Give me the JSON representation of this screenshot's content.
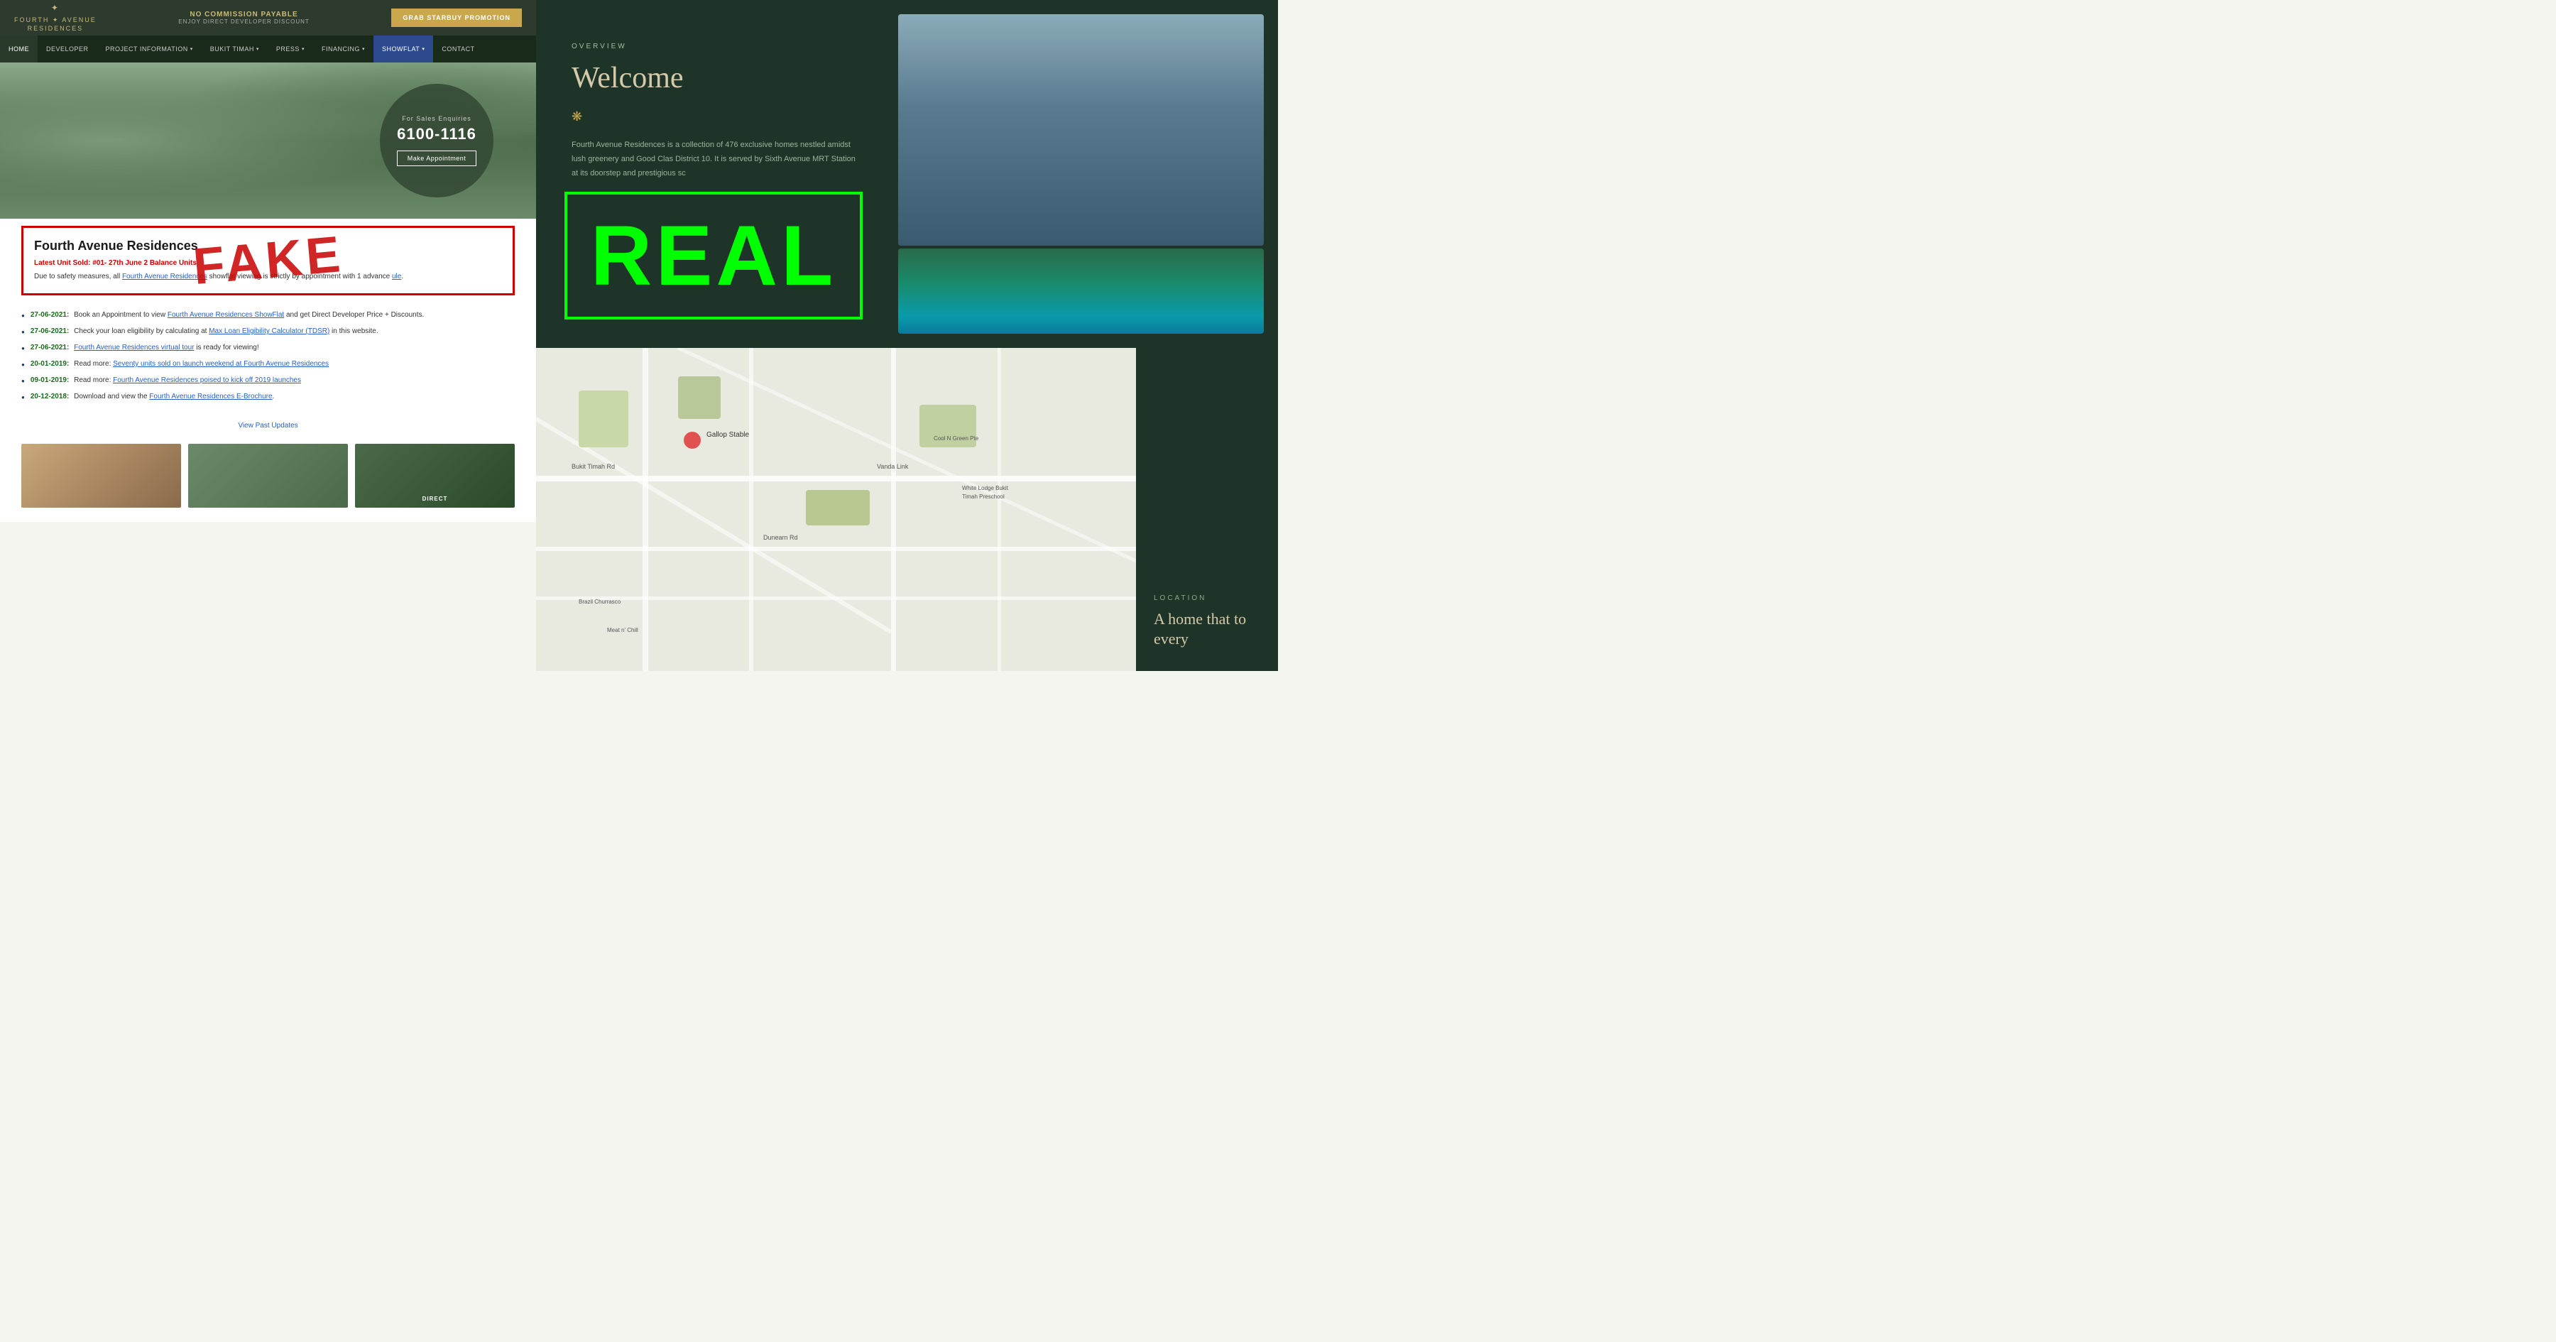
{
  "left": {
    "logo": {
      "line1": "FOURTH ✦ AVENUE",
      "line2": "RESIDENCES"
    },
    "banner": {
      "promo_title": "NO COMMISSION PAYABLE",
      "promo_sub": "ENJOY DIRECT DEVELOPER DISCOUNT",
      "grab_btn": "GRAB STARBUY PROMOTION"
    },
    "nav": {
      "items": [
        {
          "label": "HOME",
          "active": true
        },
        {
          "label": "DEVELOPER",
          "active": false
        },
        {
          "label": "PROJECT INFORMATION ▾",
          "active": false
        },
        {
          "label": "BUKIT TIMAH ▾",
          "active": false
        },
        {
          "label": "PRESS ▾",
          "active": false
        },
        {
          "label": "FINANCING ▾",
          "active": false
        },
        {
          "label": "SHOWFLAT ▾",
          "showflat": true
        },
        {
          "label": "CONTACT",
          "active": false
        }
      ]
    },
    "hero": {
      "enquiry": "For Sales Enquiries",
      "phone": "6100-1116",
      "appt_btn": "Make Appointment"
    },
    "fake_section": {
      "watermark": "FAKE",
      "title": "Fourth Avenue Residences",
      "subtitle": "d: 27th June 2",
      "latest": "Latest Unit Sold: #01-  27th June 2  Balance Units",
      "safety": "Due to safety measures, all Fourth Avenue Residences Showflat viewing is strictly by appointment with 1 advance  ule.",
      "unit_link": "Balance Units",
      "safety_link": "h Avenue Residences"
    },
    "updates": [
      {
        "date": "27-06-2021:",
        "text": "Book an Appointment to view ",
        "link": "Fourth Avenue Residences ShowFlat",
        "text2": " and get Direct Developer Price + Discounts."
      },
      {
        "date": "27-06-2021:",
        "text": "Check your loan eligibility by calculating at ",
        "link": "Max Loan Eligibility Calculator (TDSR)",
        "text2": " in this website."
      },
      {
        "date": "27-06-2021:",
        "text": "Fourth Avenue Residences virtual tour is ready for viewing!"
      },
      {
        "date": "20-01-2019:",
        "text": "Read more: ",
        "link": "Seventy units sold on launch weekend at Fourth Avenue Residences"
      },
      {
        "date": "09-01-2019:",
        "text": "Read more: ",
        "link": "Fourth Avenue Residences poised to kick off 2019 launches"
      },
      {
        "date": "20-12-2018:",
        "text": "Download and view the ",
        "link": "Fourth Avenue Residences E-Brochure",
        "text2": "."
      }
    ],
    "view_past": "View Past Updates",
    "thumb3_label": "DIRECT"
  },
  "right": {
    "overview": {
      "label": "OVERVIEW",
      "title": "Welcome",
      "ornament": "❋",
      "description": "Fourth Avenue Residences is a collection of 476 exclusive homes nestled amidst lush greenery and Good Clas District 10. It is served by Sixth Avenue MRT Station at its doorstep and prestigious sc"
    },
    "real_watermark": "REAL",
    "location": {
      "label": "LOCATION",
      "title": "A home that to every"
    },
    "map": {
      "pin_label": "Gallop Stable"
    }
  }
}
